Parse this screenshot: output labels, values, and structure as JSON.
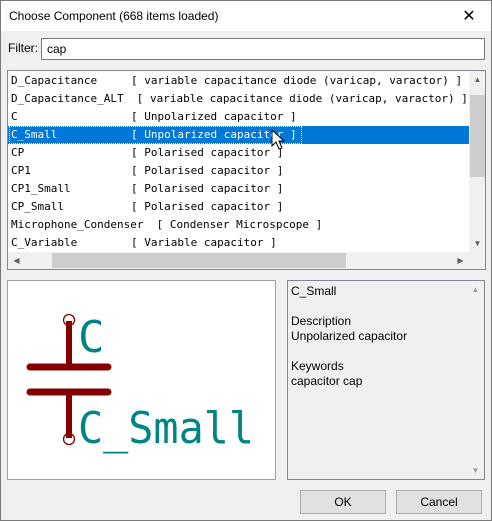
{
  "window": {
    "title": "Choose Component (668 items loaded)",
    "close_glyph": "✕"
  },
  "filter": {
    "label": "Filter:",
    "value": "cap"
  },
  "list": {
    "rows": [
      {
        "name": "D_Capacitance",
        "desc": "[ variable capacitance diode (varicap, varactor) ]",
        "selected": false
      },
      {
        "name": "D_Capacitance_ALT",
        "desc": "[ variable capacitance diode (varicap, varactor) ]",
        "selected": false
      },
      {
        "name": "C",
        "desc": "[ Unpolarized capacitor ]",
        "selected": false
      },
      {
        "name": "C_Small",
        "desc": "[ Unpolarized capacitor ]",
        "selected": true
      },
      {
        "name": "CP",
        "desc": "[ Polarised capacitor ]",
        "selected": false
      },
      {
        "name": "CP1",
        "desc": "[ Polarised capacitor ]",
        "selected": false
      },
      {
        "name": "CP1_Small",
        "desc": "[ Polarised capacitor ]",
        "selected": false
      },
      {
        "name": "CP_Small",
        "desc": "[ Polarised capacitor ]",
        "selected": false
      },
      {
        "name": "Microphone_Condenser",
        "desc": "[ Condenser Microspcope ]",
        "selected": false
      },
      {
        "name": "C_Variable",
        "desc": "[ Variable capacitor ]",
        "selected": false
      }
    ],
    "scroll_up_glyph": "▲",
    "scroll_down_glyph": "▼",
    "scroll_left_glyph": "◀",
    "scroll_right_glyph": "▶"
  },
  "preview": {
    "ref_text": "C",
    "value_text": "C_Small",
    "colors": {
      "body": "#840000",
      "text": "#008484",
      "pin": "#840000"
    }
  },
  "info": {
    "name": "C_Small",
    "description_heading": "Description",
    "description": "Unpolarized capacitor",
    "keywords_heading": "Keywords",
    "keywords": "capacitor cap"
  },
  "buttons": {
    "ok": "OK",
    "cancel": "Cancel"
  },
  "colors": {
    "selection": "#0078d7",
    "window_bg": "#f0f0f0"
  }
}
